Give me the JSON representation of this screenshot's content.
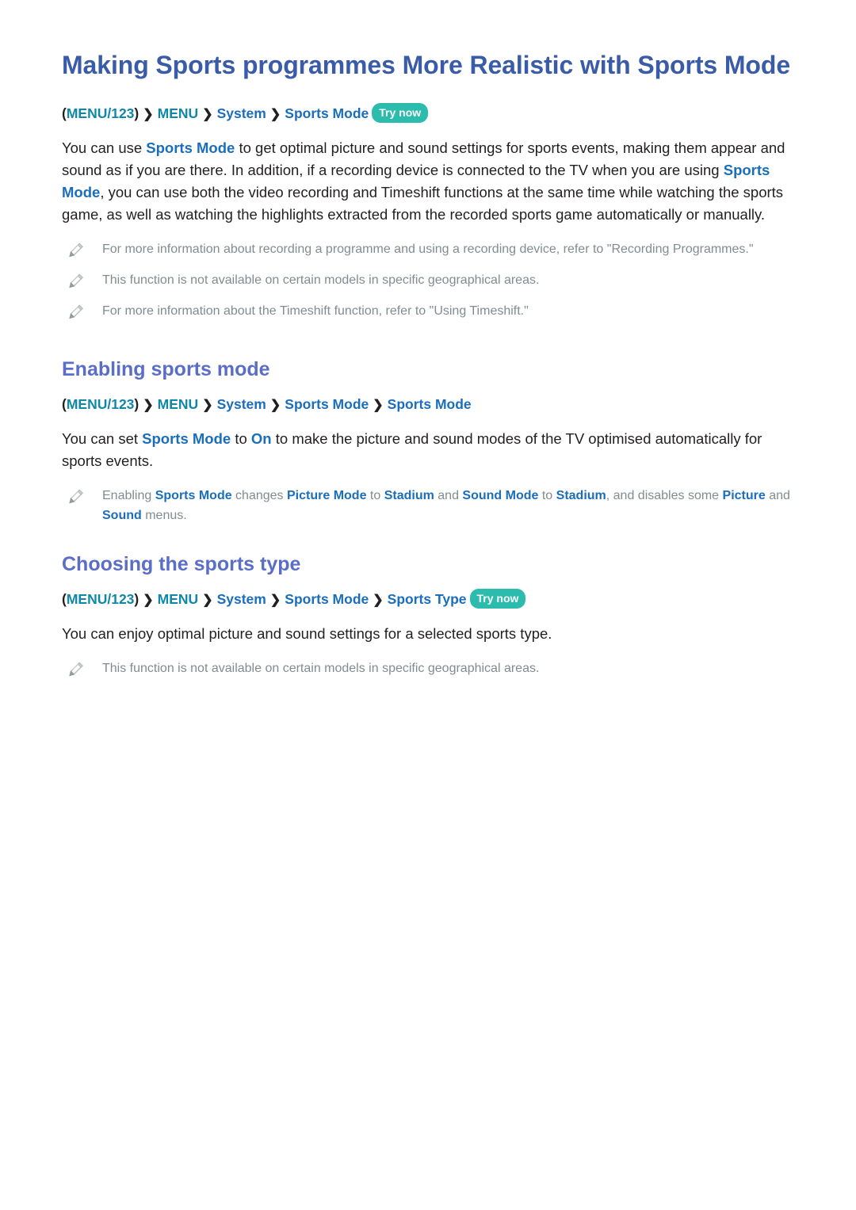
{
  "document": {
    "title": "Making Sports programmes More Realistic with Sports Mode"
  },
  "colors": {
    "title_blue": "#3a5ca8",
    "heading_violet": "#5b6ec7",
    "link_blue": "#1a6ebc",
    "menu_teal": "#0e87a8",
    "badge_teal": "#2bbcae",
    "body_text": "#231f20",
    "note_text": "#828c90"
  },
  "intro": {
    "path": {
      "open_paren": "(",
      "menu_key": "MENU/123",
      "close_paren": ")",
      "chevron": "❯",
      "items": [
        "MENU",
        "System",
        "Sports Mode"
      ],
      "menu": "MENU",
      "system": "System",
      "sports_mode": "Sports Mode",
      "try_now": "Try now"
    },
    "paragraph": {
      "t1": "You can use ",
      "l1": "Sports Mode",
      "t2": " to get optimal picture and sound settings for sports events, making them appear and sound as if you are there. In addition, if a recording device is connected to the TV when you are using ",
      "l2": "Sports Mode",
      "t3": ", you can use both the video recording and Timeshift functions at the same time while watching the sports game, as well as watching the highlights extracted from the recorded sports game automatically or manually."
    },
    "notes": [
      {
        "icon": "pencil-note-icon",
        "text": "For more information about recording a programme and using a recording device, refer to \"Recording Programmes.\""
      },
      {
        "icon": "pencil-note-icon",
        "text": "This function is not available on certain models in specific geographical areas."
      },
      {
        "icon": "pencil-note-icon",
        "text": "For more information about the Timeshift function, refer to \"Using Timeshift.\""
      }
    ]
  },
  "section_enabling": {
    "heading": "Enabling sports mode",
    "path": {
      "open_paren": "(",
      "menu_key": "MENU/123",
      "close_paren": ")",
      "chevron": "❯",
      "menu": "MENU",
      "system": "System",
      "sports_mode": "Sports Mode",
      "sports_mode_2": "Sports Mode"
    },
    "paragraph": {
      "t1": "You can set ",
      "l1": "Sports Mode",
      "t2": " to ",
      "l2": "On",
      "t3": " to make the picture and sound modes of the TV optimised automatically for sports events."
    },
    "note": {
      "icon": "pencil-note-icon",
      "t1": "Enabling ",
      "l1": "Sports Mode",
      "t2": " changes ",
      "l2": "Picture Mode",
      "t3": " to ",
      "l3": "Stadium",
      "t4": " and ",
      "l4": "Sound Mode",
      "t5": " to ",
      "l5": "Stadium",
      "t6": ", and disables some ",
      "l6": "Picture",
      "t7": " and ",
      "l7": "Sound",
      "t8": " menus."
    }
  },
  "section_choosing": {
    "heading": "Choosing the sports type",
    "path": {
      "open_paren": "(",
      "menu_key": "MENU/123",
      "close_paren": ")",
      "chevron": "❯",
      "menu": "MENU",
      "system": "System",
      "sports_mode": "Sports Mode",
      "sports_type": "Sports Type",
      "try_now": "Try now"
    },
    "paragraph": "You can enjoy optimal picture and sound settings for a selected sports type.",
    "note": {
      "icon": "pencil-note-icon",
      "text": "This function is not available on certain models in specific geographical areas."
    }
  }
}
